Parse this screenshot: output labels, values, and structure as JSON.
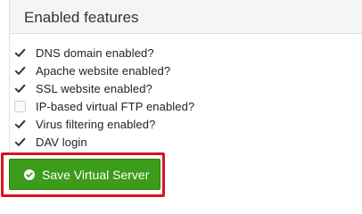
{
  "panel": {
    "title": "Enabled features",
    "features": [
      {
        "label": "DNS domain enabled?",
        "checked": true
      },
      {
        "label": "Apache website enabled?",
        "checked": true
      },
      {
        "label": "SSL website enabled?",
        "checked": true
      },
      {
        "label": "IP-based virtual FTP enabled?",
        "checked": false
      },
      {
        "label": "Virus filtering enabled?",
        "checked": true
      },
      {
        "label": "DAV login",
        "checked": true
      }
    ]
  },
  "actions": {
    "save_label": "Save Virtual Server",
    "save_icon": "check-circle-icon"
  },
  "colors": {
    "button_green": "#3c9b19",
    "highlight_red": "#d8141b"
  }
}
